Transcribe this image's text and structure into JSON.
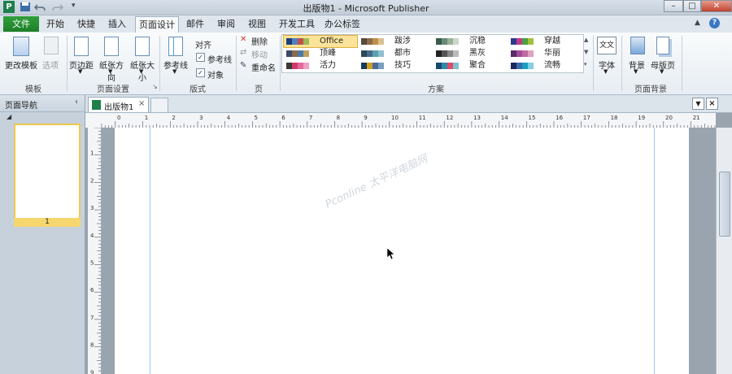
{
  "app": {
    "title": "出版物1 - Microsoft Publisher",
    "logo_letter": "P"
  },
  "tabs": [
    "文件",
    "开始",
    "快捷",
    "插入",
    "页面设计",
    "邮件",
    "审阅",
    "视图",
    "开发工具",
    "办公标签"
  ],
  "ribbon": {
    "template": {
      "change_label": "更改模板",
      "options_label": "选项",
      "group": "模板"
    },
    "page_setup": {
      "margins": "页边距",
      "orientation": "纸张方向",
      "size": "纸张大小",
      "group": "页面设置"
    },
    "layout": {
      "guides": "参考线",
      "align": "对齐",
      "guides_check": "参考线",
      "objects_check": "对象",
      "group": "版式",
      "check_mark": "✓"
    },
    "pages": {
      "delete": "删除",
      "move": "移动",
      "rename": "重命名",
      "group": "页"
    },
    "schemes": {
      "group": "方案",
      "items": [
        {
          "name": "Office",
          "colors": [
            "#1f3f7a",
            "#4f81bd",
            "#c0504d",
            "#9bbb59"
          ]
        },
        {
          "name": "跋涉",
          "colors": [
            "#5a4a3a",
            "#8c6c4c",
            "#c0904a",
            "#d8c090"
          ]
        },
        {
          "name": "沉稳",
          "colors": [
            "#3a5a4a",
            "#6a8a7a",
            "#9ab09a",
            "#c8d8c8"
          ]
        },
        {
          "name": "穿越",
          "colors": [
            "#2a3a8a",
            "#c03a8a",
            "#4aa040",
            "#a0c040"
          ]
        },
        {
          "name": "顶峰",
          "colors": [
            "#3a4a6a",
            "#8a6a4a",
            "#4a7aaa",
            "#c0a060"
          ]
        },
        {
          "name": "都市",
          "colors": [
            "#2a4a5a",
            "#4a6a8a",
            "#5aa0b0",
            "#90c0d0"
          ]
        },
        {
          "name": "黑灰",
          "colors": [
            "#222222",
            "#555555",
            "#888888",
            "#bbbbbb"
          ]
        },
        {
          "name": "华丽",
          "colors": [
            "#5a2a6a",
            "#a04a9a",
            "#c06aa0",
            "#e0a0c0"
          ]
        },
        {
          "name": "活力",
          "colors": [
            "#3a3a3a",
            "#d03a6a",
            "#e06a9a",
            "#f0a0c0"
          ]
        },
        {
          "name": "技巧",
          "colors": [
            "#1a3a5a",
            "#d0a020",
            "#4a6a9a",
            "#7aa0c0"
          ]
        },
        {
          "name": "聚合",
          "colors": [
            "#1a4a6a",
            "#2a8aaa",
            "#e04a6a",
            "#80c0d0"
          ]
        },
        {
          "name": "流畅",
          "colors": [
            "#1a2a5a",
            "#3a6aaa",
            "#1aa0c0",
            "#80d0e0"
          ]
        }
      ]
    },
    "fonts": {
      "label": "字体",
      "icon_text": "文文"
    },
    "background": {
      "bg": "背景",
      "master": "母版页",
      "group": "页面背景"
    }
  },
  "nav": {
    "title": "页面导航",
    "page_num": "1"
  },
  "doc": {
    "tab_label": "出版物1"
  },
  "ruler": {
    "h_ticks": [
      "0",
      "1",
      "2",
      "3",
      "4",
      "5",
      "6",
      "7",
      "8",
      "9",
      "10",
      "11",
      "12",
      "13",
      "14",
      "15",
      "16",
      "17",
      "18",
      "19",
      "20",
      "21"
    ],
    "v_ticks": [
      "1",
      "2",
      "3",
      "4",
      "5",
      "6",
      "7",
      "8",
      "9"
    ]
  },
  "watermark": "Pconline 太平洋电脑网"
}
